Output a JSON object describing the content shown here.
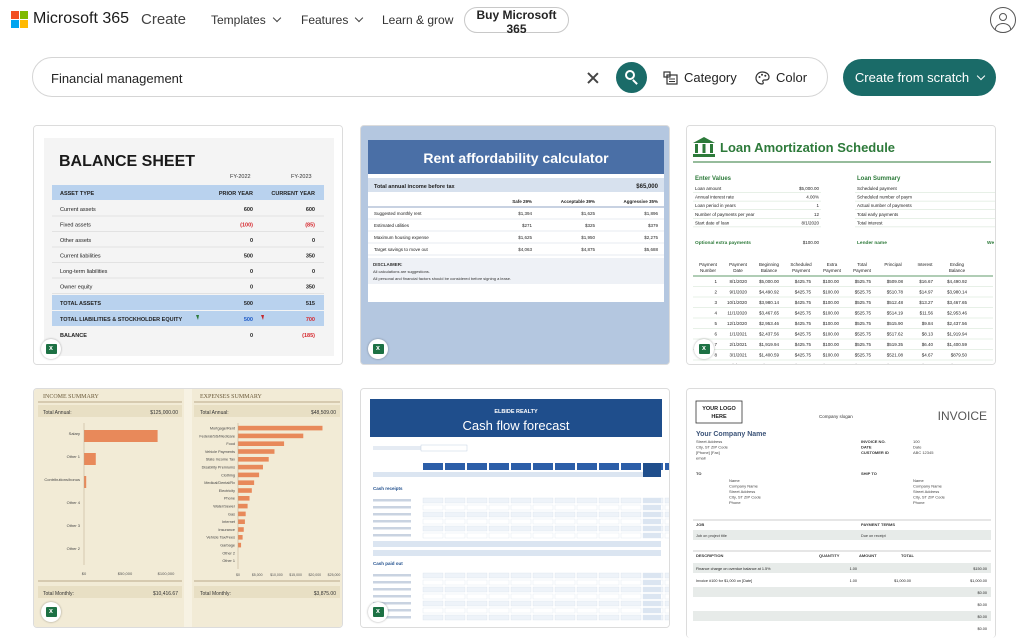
{
  "nav": {
    "brand": "Microsoft 365",
    "create": "Create",
    "templates": "Templates",
    "features": "Features",
    "learn": "Learn & grow",
    "buy": "Buy Microsoft 365",
    "logo_colors": [
      "#f25022",
      "#7fba00",
      "#00a4ef",
      "#ffb900"
    ]
  },
  "search": {
    "value": "Financial management",
    "category": "Category",
    "color": "Color"
  },
  "create_button": "Create from scratch",
  "accent": "#1a6b68",
  "cards": {
    "balance": {
      "title": "BALANCE SHEET",
      "fy1": "FY-2022",
      "fy2": "FY-2023",
      "col_asset": "ASSET TYPE",
      "col_prior": "PRIOR YEAR",
      "col_current": "CURRENT YEAR",
      "rows": [
        {
          "label": "Current assets",
          "prior": "600",
          "current": "600"
        },
        {
          "label": "Fixed assets",
          "prior": "(100)",
          "current": "(85)"
        },
        {
          "label": "Other assets",
          "prior": "0",
          "current": "0"
        },
        {
          "label": "Current liabilities",
          "prior": "500",
          "current": "350"
        },
        {
          "label": "Long-term liabilities",
          "prior": "0",
          "current": "0"
        },
        {
          "label": "Owner equity",
          "prior": "0",
          "current": "350"
        }
      ],
      "total_assets": "TOTAL ASSETS",
      "total_assets_prior": "500",
      "total_assets_current": "515",
      "total_liab": "TOTAL LIABILITIES & STOCKHOLDER EQUITY",
      "total_liab_prior": "500",
      "total_liab_current": "700",
      "balance": "BALANCE",
      "balance_prior": "0",
      "balance_current": "(185)"
    },
    "rent": {
      "title": "Rent affordability calculator",
      "income_label": "Total annual income before tax",
      "income_value": "$65,000",
      "col_safe": "Safe 29%",
      "col_accept": "Acceptable 39%",
      "col_aggr": "Aggressive 35%",
      "rows": [
        {
          "label": "Suggested monthly rent",
          "a": "$1,394",
          "b": "$1,625",
          "c": "$1,896"
        },
        {
          "label": "Estimated utilities",
          "a": "$271",
          "b": "$325",
          "c": "$379"
        },
        {
          "label": "Maximum housing expense",
          "a": "$1,625",
          "b": "$1,950",
          "c": "$2,275"
        },
        {
          "label": "Target savings to move out",
          "a": "$4,063",
          "b": "$4,875",
          "c": "$5,688"
        }
      ],
      "disclaimer_title": "DISCLAIMER:",
      "disclaimer_1": "All calculations are suggestions.",
      "disclaimer_2": "All personal and financial factors should be considered before signing a lease."
    },
    "loan": {
      "title": "Loan Amortization Schedule",
      "enter_values": "Enter Values",
      "loan_summary": "Loan Summary",
      "inputs": [
        {
          "label": "Loan amount",
          "value": "$5,000.00"
        },
        {
          "label": "Annual interest rate",
          "value": "4.00%"
        },
        {
          "label": "Loan period in years",
          "value": "1"
        },
        {
          "label": "Number of payments per year",
          "value": "12"
        },
        {
          "label": "Start date of loan",
          "value": "8/1/2020"
        }
      ],
      "optional": "Optional extra payments",
      "optional_value": "$100.00",
      "summary": [
        "Scheduled payment",
        "Scheduled number of paym",
        "Actual number of payments",
        "Total early payments",
        "Total interest"
      ],
      "lender": "Lender name",
      "lender_value": "We",
      "headers": [
        "Payment Number",
        "Payment Date",
        "Beginning Balance",
        "Scheduled Payment",
        "Extra Payment",
        "Total Payment",
        "Principal",
        "Interest",
        "Ending Balance"
      ],
      "rows": [
        [
          "1",
          "8/1/2020",
          "$5,000.00",
          "$425.75",
          "$100.00",
          "$525.75",
          "$509.08",
          "$16.67",
          "$4,490.92"
        ],
        [
          "2",
          "9/1/2020",
          "$4,490.92",
          "$425.75",
          "$100.00",
          "$525.75",
          "$510.78",
          "$14.97",
          "$3,980.14"
        ],
        [
          "3",
          "10/1/2020",
          "$3,980.14",
          "$425.75",
          "$100.00",
          "$525.75",
          "$512.48",
          "$13.27",
          "$3,467.65"
        ],
        [
          "4",
          "11/1/2020",
          "$3,467.65",
          "$425.75",
          "$100.00",
          "$525.75",
          "$514.19",
          "$11.56",
          "$2,953.46"
        ],
        [
          "5",
          "12/1/2020",
          "$2,953.46",
          "$425.75",
          "$100.00",
          "$525.75",
          "$515.90",
          "$9.84",
          "$2,437.56"
        ],
        [
          "6",
          "1/1/2021",
          "$2,437.56",
          "$425.75",
          "$100.00",
          "$525.75",
          "$517.62",
          "$8.13",
          "$1,919.94"
        ],
        [
          "7",
          "2/1/2021",
          "$1,919.94",
          "$425.75",
          "$100.00",
          "$525.75",
          "$519.35",
          "$6.40",
          "$1,400.59"
        ],
        [
          "8",
          "3/1/2021",
          "$1,400.59",
          "$425.75",
          "$100.00",
          "$525.75",
          "$521.08",
          "$4.67",
          "$879.50"
        ],
        [
          "9",
          "4/1/2021",
          "$879.50",
          "$425.75",
          "$100.00",
          "$525.75",
          "$522.82",
          "$2.93",
          "$356.69"
        ]
      ]
    },
    "income": {
      "income_title": "INCOME SUMMARY",
      "expense_title": "EXPENSES SUMMARY",
      "total_annual": "Total Annual:",
      "income_annual": "$125,000.00",
      "expense_annual": "$48,509.00",
      "income_bars": [
        {
          "label": "Salary",
          "value": 100000
        },
        {
          "label": "Other 1",
          "value": 16000
        },
        {
          "label": "Contributions/bonus",
          "value": 3000
        },
        {
          "label": "Other 4",
          "value": 0
        },
        {
          "label": "Other 3",
          "value": 0
        },
        {
          "label": "Other 2",
          "value": 0
        }
      ],
      "income_ticks": [
        "$0",
        "$50,000",
        "$100,000"
      ],
      "expense_bars": [
        {
          "label": "Mortgage/Rent",
          "value": 22000
        },
        {
          "label": "Federal/SS/Medicare",
          "value": 17000
        },
        {
          "label": "Food",
          "value": 12000
        },
        {
          "label": "Vehicle Payments",
          "value": 9500
        },
        {
          "label": "State Income Tax",
          "value": 8000
        },
        {
          "label": "Disability Premiums",
          "value": 6500
        },
        {
          "label": "Clothing",
          "value": 5500
        },
        {
          "label": "Medical/Dental/Rx",
          "value": 4200
        },
        {
          "label": "Electricity",
          "value": 3600
        },
        {
          "label": "Phone",
          "value": 3000
        },
        {
          "label": "Water/Sewer",
          "value": 2500
        },
        {
          "label": "Gas",
          "value": 2000
        },
        {
          "label": "Internet",
          "value": 1800
        },
        {
          "label": "Insurance",
          "value": 1500
        },
        {
          "label": "Vehicle Tax/Fees",
          "value": 1200
        },
        {
          "label": "Garbage",
          "value": 800
        },
        {
          "label": "Other 2",
          "value": 0
        },
        {
          "label": "Other 1",
          "value": 0
        }
      ],
      "expense_ticks": [
        "$0",
        "$5,000",
        "$10,000",
        "$15,000",
        "$20,000",
        "$25,000"
      ],
      "total_monthly": "Total Monthly:",
      "income_monthly": "$10,416.67",
      "expense_monthly": "$3,875.00",
      "bar_color": "#e8895a"
    },
    "cashflow": {
      "company": "ELBIDE REALTY",
      "title": "Cash flow forecast",
      "cash_receipts": "Cash receipts",
      "cash_paid_out": "Cash paid out"
    },
    "invoice": {
      "logo": "YOUR LOGO HERE",
      "slogan": "Company slogan",
      "title": "INVOICE",
      "company": "Your Company Name",
      "address_lines": [
        "Street Address",
        "City, ST ZIP Code",
        "[Phone] [Fax]",
        "email"
      ],
      "invoice_no_label": "INVOICE NO.",
      "invoice_no": "100",
      "date_label": "DATE",
      "date": "Date",
      "customer_label": "CUSTOMER ID",
      "customer": "ABC 12345",
      "to": "TO",
      "ship_to": "SHIP TO",
      "recipient": [
        "Name",
        "Company Name",
        "Street Address",
        "City, ST ZIP Code",
        "Phone"
      ],
      "job": "JOB",
      "payment_terms": "PAYMENT TERMS",
      "job_value": "Job on project title",
      "terms_value": "Due on receipt",
      "description": "DESCRIPTION",
      "quantity": "QUANTITY",
      "amount": "AMOUNT",
      "total": "TOTAL",
      "lines": [
        {
          "desc": "Finance charge on overdue balance at 1.5%",
          "qty": "1.00",
          "amount": "",
          "total": "$150.00"
        },
        {
          "desc": "Invoice #100 for $1,000 on [Date]",
          "qty": "1.00",
          "amount": "$1,000.00",
          "total": "$1,000.00"
        }
      ],
      "zero": "$0.00"
    }
  }
}
